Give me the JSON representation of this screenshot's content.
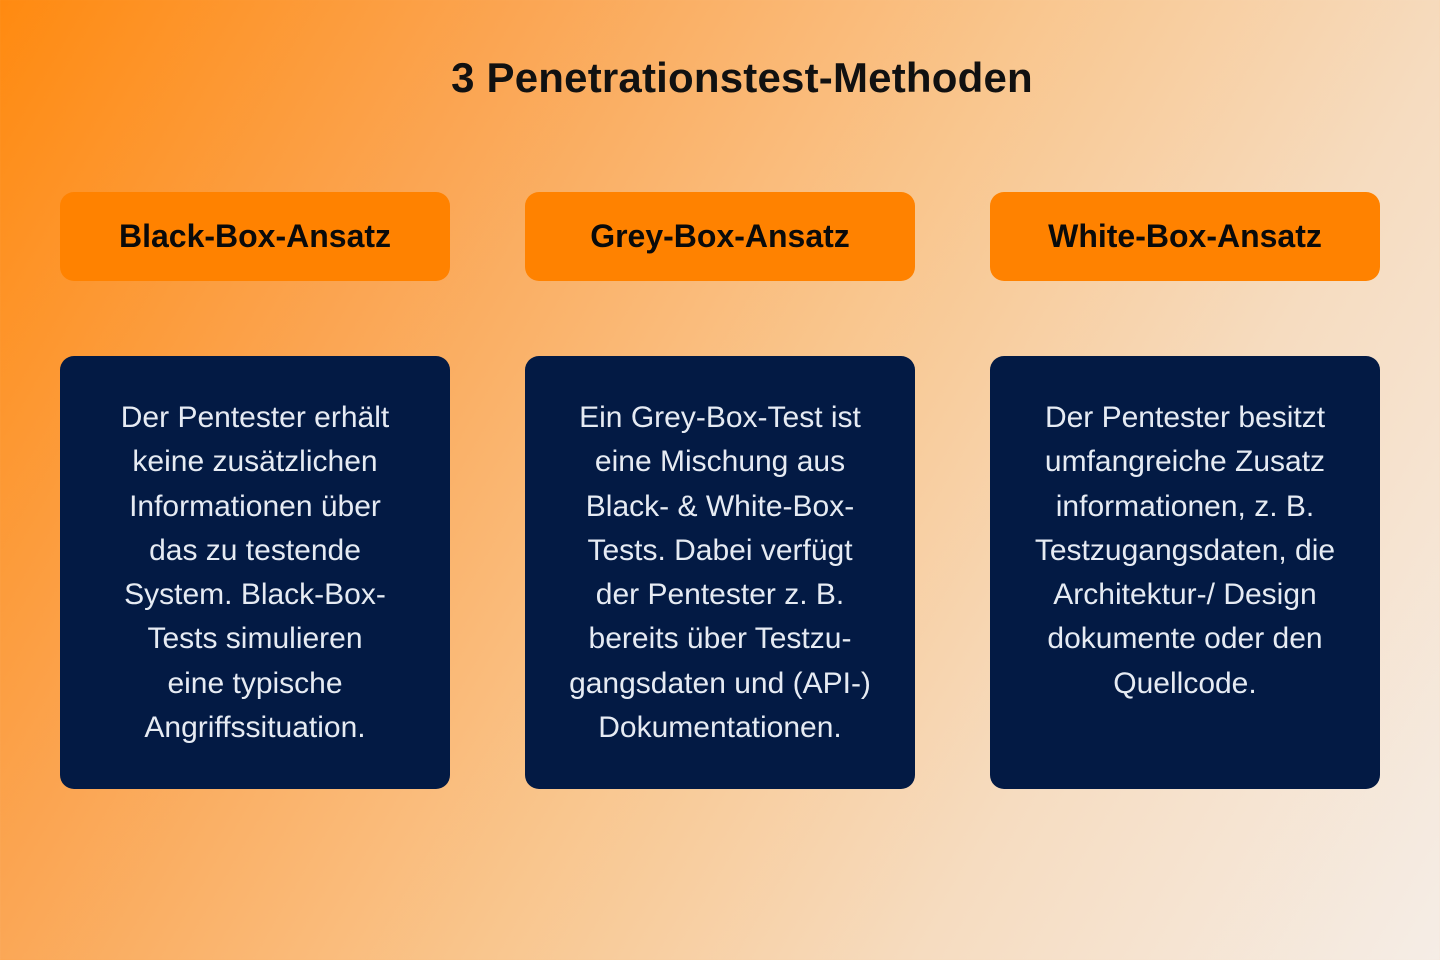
{
  "title": "3 Penetrationstest-Methoden",
  "columns": [
    {
      "heading": "Black-Box-Ansatz",
      "lines": [
        "Der Pentester erhält",
        "keine zusätzlichen",
        "Informationen über",
        "das zu testende",
        "System. Black-Box-",
        "Tests simulieren",
        "eine typische",
        "Angriffssituation."
      ]
    },
    {
      "heading": "Grey-Box-Ansatz",
      "lines": [
        "Ein Grey-Box-Test ist",
        "eine Mischung aus",
        "Black- & White-Box-",
        "Tests. Dabei verfügt",
        "der Pentester z. B.",
        "bereits über Testzu-",
        "gangsdaten und (API-)",
        "Dokumentationen."
      ]
    },
    {
      "heading": "White-Box-Ansatz",
      "lines": [
        "Der Pentester besitzt",
        "umfangreiche Zusatz",
        "informationen, z. B.",
        "Testzugangsdaten, die",
        "Architektur-/ Design",
        "dokumente oder den",
        "Quellcode."
      ]
    }
  ],
  "colors": {
    "heading_bg": "#ff8200",
    "card_bg": "#031a44",
    "card_text": "#e6ebf3",
    "title_text": "#111111"
  }
}
